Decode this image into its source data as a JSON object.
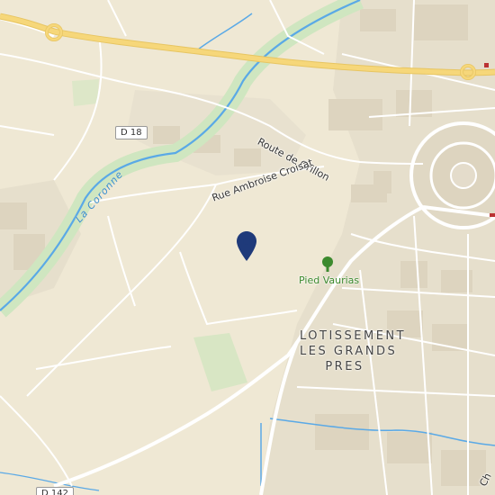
{
  "map": {
    "road_labels": {
      "route_grillon": "Route de Grillon",
      "rue_ambroise": "Rue Ambroise Croisat",
      "partial_chemin": "Ch"
    },
    "road_shields": {
      "d18": "D 18",
      "d142": "D 142"
    },
    "water_labels": {
      "la_coronne": "La Coronne"
    },
    "area_labels": {
      "lotissement_line1": "LOTISSEMENT",
      "lotissement_line2": "LES GRANDS",
      "lotissement_line3": "PRES"
    },
    "poi_labels": {
      "pied_vaurias": "Pied Vaurias"
    },
    "colors": {
      "land": "#efe8d4",
      "urban": "#e4dccb",
      "highway": "#f6d77a",
      "river": "#5aa9e6",
      "river_buffer": "#c9e6b8",
      "marker": "#1f3a7a",
      "park": "#d8e6c4"
    },
    "marker_icon": "map-pin-icon",
    "tree_icon": "tree-icon"
  }
}
